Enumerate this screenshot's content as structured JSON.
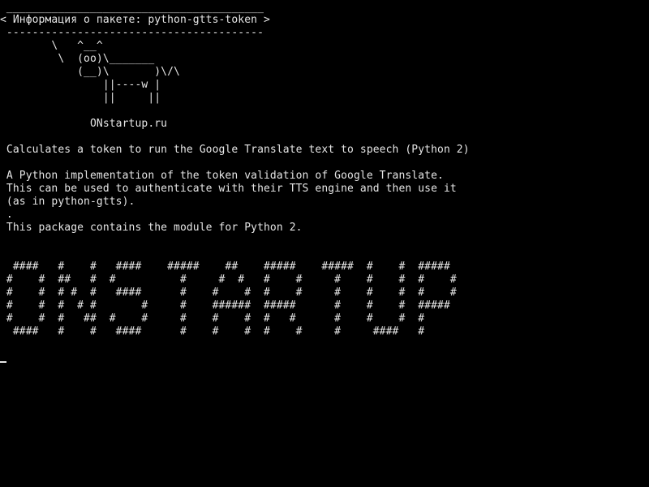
{
  "terminal": {
    "colors": {
      "background": "#000000",
      "foreground": "#e6e6e6"
    },
    "cow": {
      "border_top": " ________________________________________",
      "title": "< Информация о пакете: python-gtts-token >",
      "border_bottom": " ----------------------------------------",
      "art": [
        "        \\   ^__^",
        "         \\  (oo)\\_______",
        "            (__)\\       )\\/\\",
        "                ||----w |",
        "                ||     ||"
      ],
      "site": "              ONstartup.ru"
    },
    "description": {
      "summary": " Calculates a token to run the Google Translate text to speech (Python 2)",
      "body": [
        " A Python implementation of the token validation of Google Translate.",
        " This can be used to authenticate with their TTS engine and then use it",
        " (as in python-gtts).",
        " .",
        " This package contains the module for Python 2."
      ]
    },
    "banner": [
      "  ####   #    #   ####    #####    ##    #####    #####  #    #  #####",
      " #    #  ##   #  #          #     #  #   #    #     #    #    #  #    #",
      " #    #  # #  #   ####      #    #    #  #    #     #    #    #  #    #",
      " #    #  #  # #       #     #    ######  #####      #    #    #  #####",
      " #    #  #   ##  #    #     #    #    #  #   #      #    #    #  #",
      "  ####   #    #   ####      #    #    #  #    #     #     ####   #"
    ]
  }
}
